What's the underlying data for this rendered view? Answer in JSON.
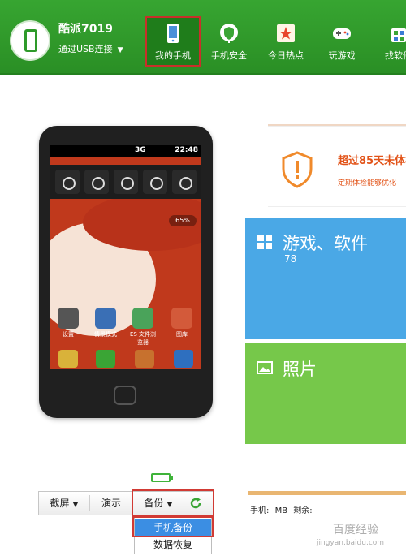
{
  "header": {
    "device_name": "酷派7019",
    "connection": "通过USB连接",
    "nav": [
      {
        "label": "我的手机",
        "icon": "phone-icon",
        "active": true
      },
      {
        "label": "手机安全",
        "icon": "shield-icon"
      },
      {
        "label": "今日热点",
        "icon": "star-icon"
      },
      {
        "label": "玩游戏",
        "icon": "gamepad-icon"
      },
      {
        "label": "找软件",
        "icon": "app-store-icon"
      }
    ]
  },
  "phone_screen": {
    "status_network": "3G",
    "status_time": "22:48",
    "battery_pill": "65%",
    "apps": [
      "设置",
      "情景模式",
      "ES 文件浏览器",
      "图库"
    ],
    "dock": [
      "SMS",
      "电话",
      "联系人",
      "应用"
    ]
  },
  "alert": {
    "title": "超过85天未体检",
    "subtitle": "定期体检能够优化"
  },
  "tiles": {
    "apps": {
      "title": "游戏、软件",
      "count": "78"
    },
    "photos": {
      "title": "照片"
    }
  },
  "toolbar": {
    "screenshot": "截屏",
    "demo": "演示",
    "backup": "备份"
  },
  "backup_menu": {
    "items": [
      "手机备份",
      "数据恢复"
    ],
    "selected": "手机备份"
  },
  "storage": {
    "phone_label": "手机:",
    "phone_value": "MB",
    "remaining_label": "剩余:"
  },
  "watermark": {
    "line1": "百度经验",
    "line2": "jingyan.baidu.com"
  },
  "colors": {
    "header_green": "#2e9a2a",
    "tile_blue": "#4aa8e6",
    "tile_green": "#76c84a",
    "alert_orange": "#e25318",
    "highlight_red": "#d13a34"
  }
}
